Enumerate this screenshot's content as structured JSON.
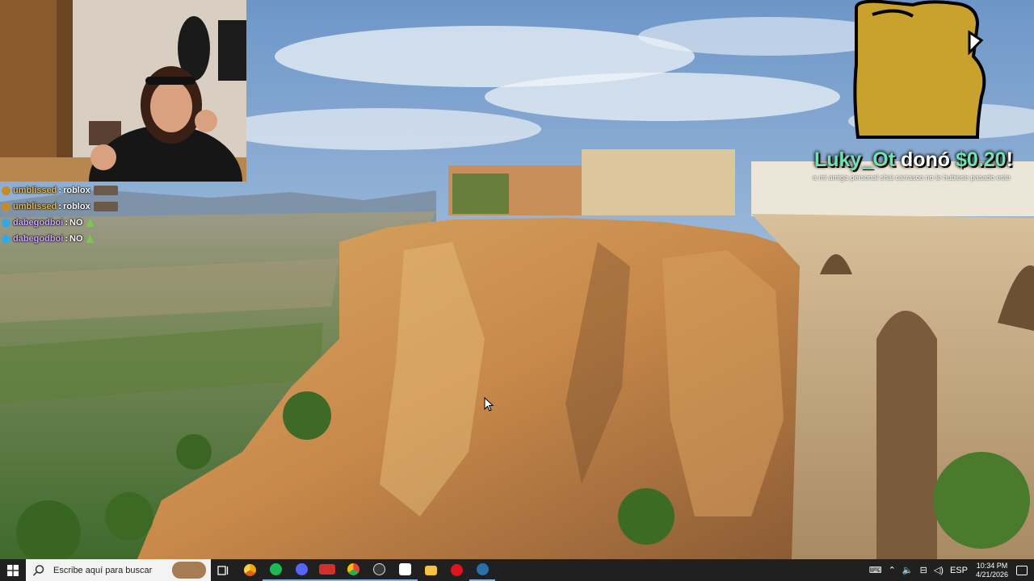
{
  "chat": {
    "messages": [
      {
        "user": "umblissed",
        "sep": ":",
        "text": "roblox",
        "user_color": "#e8b64a",
        "badge_color": "#c58b2a"
      },
      {
        "user": "umblissed",
        "sep": ":",
        "text": "roblox",
        "user_color": "#e8b64a",
        "badge_color": "#c58b2a"
      },
      {
        "user": "dabegodboi",
        "sep": ":",
        "text": "NO",
        "user_color": "#c9a7ff",
        "badge_color": "#3aa6e0"
      },
      {
        "user": "dabegodboi",
        "sep": ":",
        "text": "NO",
        "user_color": "#c9a7ff",
        "badge_color": "#3aa6e0"
      }
    ]
  },
  "donation": {
    "name": "Luky_Ot",
    "verb": " donó ",
    "amount": "$0.20",
    "suffix": "!",
    "message": "a mi amiga personal shai carrasco no le hubiese pasado esto"
  },
  "taskbar": {
    "search_placeholder": "Escribe aquí para buscar",
    "apps": [
      {
        "name": "task-view",
        "color": "#ffffff"
      },
      {
        "name": "chrome-canary",
        "color": "#f2a900"
      },
      {
        "name": "spotify",
        "color": "#1db954"
      },
      {
        "name": "discord",
        "color": "#5865f2"
      },
      {
        "name": "voicemeeter",
        "color": "#d2302c"
      },
      {
        "name": "chrome",
        "color": "#4285f4"
      },
      {
        "name": "obs",
        "color": "#3a3a3a"
      },
      {
        "name": "epic",
        "color": "#ffffff"
      },
      {
        "name": "file-explorer",
        "color": "#f5c242"
      },
      {
        "name": "opera",
        "color": "#e0131e"
      },
      {
        "name": "steam",
        "color": "#5aa7e0"
      }
    ],
    "language": "ESP",
    "time": "10:34 PM",
    "date": "4/21/2026"
  },
  "colors": {
    "taskbar_bg": "#202020",
    "alert_accent": "#6fe3b6"
  }
}
